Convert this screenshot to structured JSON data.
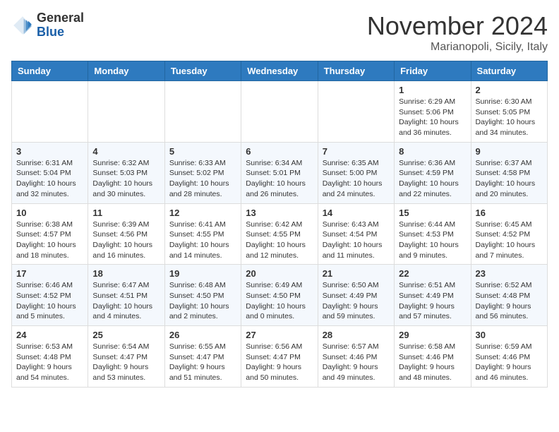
{
  "header": {
    "logo_line1": "General",
    "logo_line2": "Blue",
    "month_title": "November 2024",
    "location": "Marianopoli, Sicily, Italy"
  },
  "weekdays": [
    "Sunday",
    "Monday",
    "Tuesday",
    "Wednesday",
    "Thursday",
    "Friday",
    "Saturday"
  ],
  "weeks": [
    [
      {
        "day": "",
        "info": ""
      },
      {
        "day": "",
        "info": ""
      },
      {
        "day": "",
        "info": ""
      },
      {
        "day": "",
        "info": ""
      },
      {
        "day": "",
        "info": ""
      },
      {
        "day": "1",
        "info": "Sunrise: 6:29 AM\nSunset: 5:06 PM\nDaylight: 10 hours and 36 minutes."
      },
      {
        "day": "2",
        "info": "Sunrise: 6:30 AM\nSunset: 5:05 PM\nDaylight: 10 hours and 34 minutes."
      }
    ],
    [
      {
        "day": "3",
        "info": "Sunrise: 6:31 AM\nSunset: 5:04 PM\nDaylight: 10 hours and 32 minutes."
      },
      {
        "day": "4",
        "info": "Sunrise: 6:32 AM\nSunset: 5:03 PM\nDaylight: 10 hours and 30 minutes."
      },
      {
        "day": "5",
        "info": "Sunrise: 6:33 AM\nSunset: 5:02 PM\nDaylight: 10 hours and 28 minutes."
      },
      {
        "day": "6",
        "info": "Sunrise: 6:34 AM\nSunset: 5:01 PM\nDaylight: 10 hours and 26 minutes."
      },
      {
        "day": "7",
        "info": "Sunrise: 6:35 AM\nSunset: 5:00 PM\nDaylight: 10 hours and 24 minutes."
      },
      {
        "day": "8",
        "info": "Sunrise: 6:36 AM\nSunset: 4:59 PM\nDaylight: 10 hours and 22 minutes."
      },
      {
        "day": "9",
        "info": "Sunrise: 6:37 AM\nSunset: 4:58 PM\nDaylight: 10 hours and 20 minutes."
      }
    ],
    [
      {
        "day": "10",
        "info": "Sunrise: 6:38 AM\nSunset: 4:57 PM\nDaylight: 10 hours and 18 minutes."
      },
      {
        "day": "11",
        "info": "Sunrise: 6:39 AM\nSunset: 4:56 PM\nDaylight: 10 hours and 16 minutes."
      },
      {
        "day": "12",
        "info": "Sunrise: 6:41 AM\nSunset: 4:55 PM\nDaylight: 10 hours and 14 minutes."
      },
      {
        "day": "13",
        "info": "Sunrise: 6:42 AM\nSunset: 4:55 PM\nDaylight: 10 hours and 12 minutes."
      },
      {
        "day": "14",
        "info": "Sunrise: 6:43 AM\nSunset: 4:54 PM\nDaylight: 10 hours and 11 minutes."
      },
      {
        "day": "15",
        "info": "Sunrise: 6:44 AM\nSunset: 4:53 PM\nDaylight: 10 hours and 9 minutes."
      },
      {
        "day": "16",
        "info": "Sunrise: 6:45 AM\nSunset: 4:52 PM\nDaylight: 10 hours and 7 minutes."
      }
    ],
    [
      {
        "day": "17",
        "info": "Sunrise: 6:46 AM\nSunset: 4:52 PM\nDaylight: 10 hours and 5 minutes."
      },
      {
        "day": "18",
        "info": "Sunrise: 6:47 AM\nSunset: 4:51 PM\nDaylight: 10 hours and 4 minutes."
      },
      {
        "day": "19",
        "info": "Sunrise: 6:48 AM\nSunset: 4:50 PM\nDaylight: 10 hours and 2 minutes."
      },
      {
        "day": "20",
        "info": "Sunrise: 6:49 AM\nSunset: 4:50 PM\nDaylight: 10 hours and 0 minutes."
      },
      {
        "day": "21",
        "info": "Sunrise: 6:50 AM\nSunset: 4:49 PM\nDaylight: 9 hours and 59 minutes."
      },
      {
        "day": "22",
        "info": "Sunrise: 6:51 AM\nSunset: 4:49 PM\nDaylight: 9 hours and 57 minutes."
      },
      {
        "day": "23",
        "info": "Sunrise: 6:52 AM\nSunset: 4:48 PM\nDaylight: 9 hours and 56 minutes."
      }
    ],
    [
      {
        "day": "24",
        "info": "Sunrise: 6:53 AM\nSunset: 4:48 PM\nDaylight: 9 hours and 54 minutes."
      },
      {
        "day": "25",
        "info": "Sunrise: 6:54 AM\nSunset: 4:47 PM\nDaylight: 9 hours and 53 minutes."
      },
      {
        "day": "26",
        "info": "Sunrise: 6:55 AM\nSunset: 4:47 PM\nDaylight: 9 hours and 51 minutes."
      },
      {
        "day": "27",
        "info": "Sunrise: 6:56 AM\nSunset: 4:47 PM\nDaylight: 9 hours and 50 minutes."
      },
      {
        "day": "28",
        "info": "Sunrise: 6:57 AM\nSunset: 4:46 PM\nDaylight: 9 hours and 49 minutes."
      },
      {
        "day": "29",
        "info": "Sunrise: 6:58 AM\nSunset: 4:46 PM\nDaylight: 9 hours and 48 minutes."
      },
      {
        "day": "30",
        "info": "Sunrise: 6:59 AM\nSunset: 4:46 PM\nDaylight: 9 hours and 46 minutes."
      }
    ]
  ]
}
